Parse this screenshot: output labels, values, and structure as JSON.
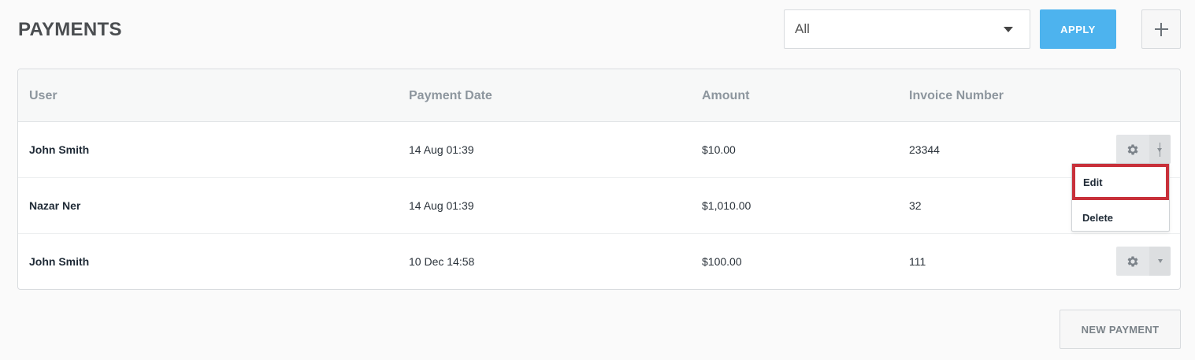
{
  "header": {
    "title": "PAYMENTS",
    "filter": {
      "selected": "All"
    },
    "apply_label": "APPLY",
    "add_icon": "plus-icon"
  },
  "table": {
    "columns": [
      "User",
      "Payment Date",
      "Amount",
      "Invoice Number"
    ],
    "rows": [
      {
        "user": "John Smith",
        "date": "14 Aug 01:39",
        "amount": "$10.00",
        "invoice": "23344"
      },
      {
        "user": "Nazar Ner",
        "date": "14 Aug 01:39",
        "amount": "$1,010.00",
        "invoice": "32"
      },
      {
        "user": "John Smith",
        "date": "10 Dec 14:58",
        "amount": "$100.00",
        "invoice": "111"
      }
    ],
    "row_actions_icon": "gear-icon"
  },
  "dropdown": {
    "items": [
      "Edit",
      "Delete"
    ],
    "highlight_color": "#c8303a"
  },
  "footer": {
    "new_payment_label": "NEW PAYMENT"
  },
  "colors": {
    "accent": "#4db3ee"
  }
}
